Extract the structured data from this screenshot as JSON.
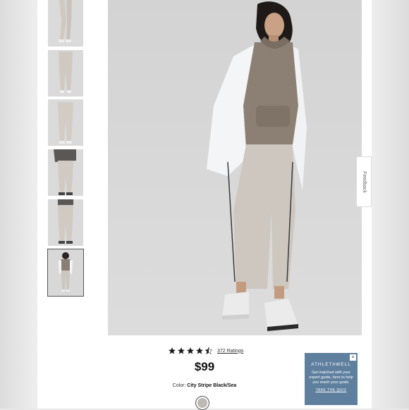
{
  "feedback": {
    "label": "Feedback"
  },
  "product": {
    "rating_value": 4.5,
    "rating_max": 5,
    "ratings_link": "372 Ratings",
    "price": "$99",
    "color_label": "Color:",
    "color_value": "City Stripe Black/Sea"
  },
  "ad": {
    "close": "×",
    "brand": "ATHLETAWELL",
    "text": "Get matched with your expert guide, here to help you reach your goals.",
    "cta": "TAKE THE QUIZ"
  },
  "colors": {
    "star": "#1a1a1a",
    "ad_bg": "#5e7f9d",
    "hero_bg": "#d6d6d6"
  }
}
